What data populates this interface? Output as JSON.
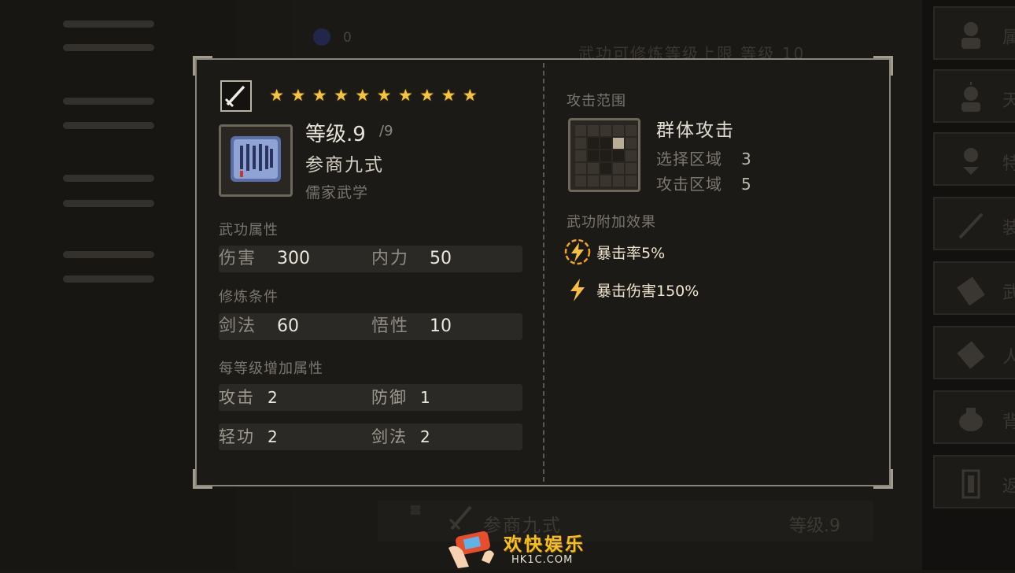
{
  "background": {
    "coin_value": "0",
    "top_text": "武功可修炼等级上限 等级 10",
    "bottom_row": {
      "skill_name": "参商九式",
      "level": "等级.9"
    },
    "side_tabs": [
      {
        "label": "属",
        "icon": "character-icon"
      },
      {
        "label": "天",
        "icon": "talent-icon"
      },
      {
        "label": "特",
        "icon": "trait-icon"
      },
      {
        "label": "装",
        "icon": "sword-icon"
      },
      {
        "label": "武",
        "icon": "martial-book-icon"
      },
      {
        "label": "人",
        "icon": "scroll-icon"
      },
      {
        "label": "背",
        "icon": "bag-icon"
      },
      {
        "label": "返",
        "icon": "door-icon"
      }
    ]
  },
  "popup": {
    "stars": 10,
    "level": "等级.9",
    "level_max": "/9",
    "skill_name": "参商九式",
    "school": "儒家武学",
    "attributes_title": "武功属性",
    "attributes": [
      {
        "name": "伤害",
        "value": "300"
      },
      {
        "name": "内力",
        "value": "50"
      }
    ],
    "requirements_title": "修炼条件",
    "requirements": [
      {
        "name": "剑法",
        "value": "60"
      },
      {
        "name": "悟性",
        "value": "10"
      }
    ],
    "per_level_title": "每等级增加属性",
    "per_level": [
      {
        "name": "攻击",
        "value": "2"
      },
      {
        "name": "防御",
        "value": "1"
      },
      {
        "name": "轻功",
        "value": "2"
      },
      {
        "name": "剑法",
        "value": "2"
      }
    ],
    "range_title": "攻击范围",
    "range_name": "群体攻击",
    "select_area_label": "选择区域",
    "select_area_value": "3",
    "attack_area_label": "攻击区域",
    "attack_area_value": "5",
    "effects_title": "武功附加效果",
    "effects": [
      {
        "label": "暴击率5%",
        "icon": "lightning-circle-icon"
      },
      {
        "label": "暴击伤害150%",
        "icon": "lightning-icon"
      }
    ]
  },
  "watermark": {
    "text": "欢快娱乐",
    "sub": "HK1C.COM"
  },
  "colors": {
    "star": "#f3c540",
    "panel": "#1c1a17",
    "border": "#8a857a",
    "accent": "#f2c020"
  }
}
